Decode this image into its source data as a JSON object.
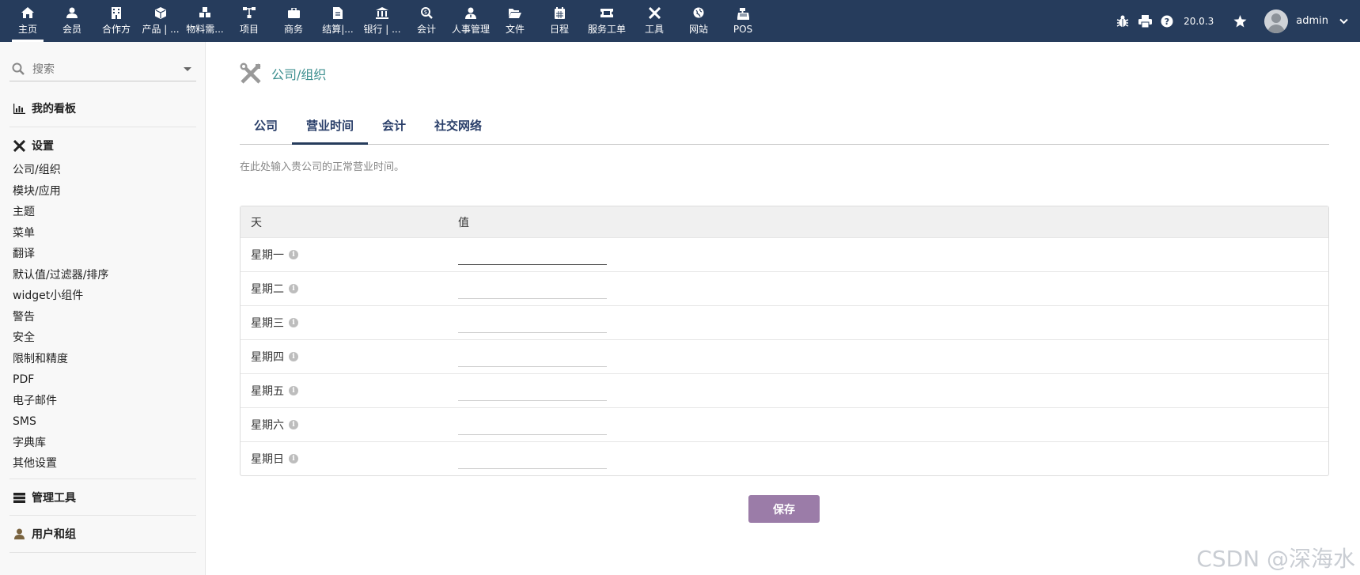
{
  "topbar": {
    "menu": [
      {
        "label": "主页",
        "icon": "home-icon",
        "active": true
      },
      {
        "label": "会员",
        "icon": "user-icon"
      },
      {
        "label": "合作方",
        "icon": "building-icon"
      },
      {
        "label": "产品 | ...",
        "icon": "cube-icon"
      },
      {
        "label": "物料需...",
        "icon": "cubes-icon"
      },
      {
        "label": "项目",
        "icon": "sitemap-icon"
      },
      {
        "label": "商务",
        "icon": "briefcase-icon"
      },
      {
        "label": "结算|...",
        "icon": "file-invoice-icon"
      },
      {
        "label": "银行 | ...",
        "icon": "bank-icon"
      },
      {
        "label": "会计",
        "icon": "search-dollar-icon"
      },
      {
        "label": "人事管理",
        "icon": "user-tie-icon"
      },
      {
        "label": "文件",
        "icon": "folder-open-icon"
      },
      {
        "label": "日程",
        "icon": "calendar-icon"
      },
      {
        "label": "服务工单",
        "icon": "ticket-icon"
      },
      {
        "label": "工具",
        "icon": "tools-icon"
      },
      {
        "label": "网站",
        "icon": "globe-icon"
      },
      {
        "label": "POS",
        "icon": "cash-register-icon"
      }
    ],
    "version": "20.0.3",
    "username": "admin"
  },
  "sidebar": {
    "search_placeholder": "搜索",
    "dashboard": "我的看板",
    "settings": "设置",
    "links": [
      "公司/组织",
      "模块/应用",
      "主题",
      "菜单",
      "翻译",
      "默认值/过滤器/排序",
      "widget小组件",
      "警告",
      "安全",
      "限制和精度",
      "PDF",
      "电子邮件",
      "SMS",
      "字典库",
      "其他设置"
    ],
    "admin_tools": "管理工具",
    "users_groups": "用户和组"
  },
  "main": {
    "title": "公司/组织",
    "tabs": [
      {
        "label": "公司"
      },
      {
        "label": "营业时间",
        "active": true
      },
      {
        "label": "会计"
      },
      {
        "label": "社交网络"
      }
    ],
    "description": "在此处输入贵公司的正常营业时间。",
    "table": {
      "col_day": "天",
      "col_value": "值",
      "rows": [
        {
          "day": "星期一",
          "value": ""
        },
        {
          "day": "星期二",
          "value": ""
        },
        {
          "day": "星期三",
          "value": ""
        },
        {
          "day": "星期四",
          "value": ""
        },
        {
          "day": "星期五",
          "value": ""
        },
        {
          "day": "星期六",
          "value": ""
        },
        {
          "day": "星期日",
          "value": ""
        }
      ]
    },
    "save_label": "保存"
  },
  "watermark": "CSDN @深海水",
  "colors": {
    "topbar": "#263c5c",
    "save_button": "#9b7ca8",
    "title": "#3b8e8e"
  }
}
